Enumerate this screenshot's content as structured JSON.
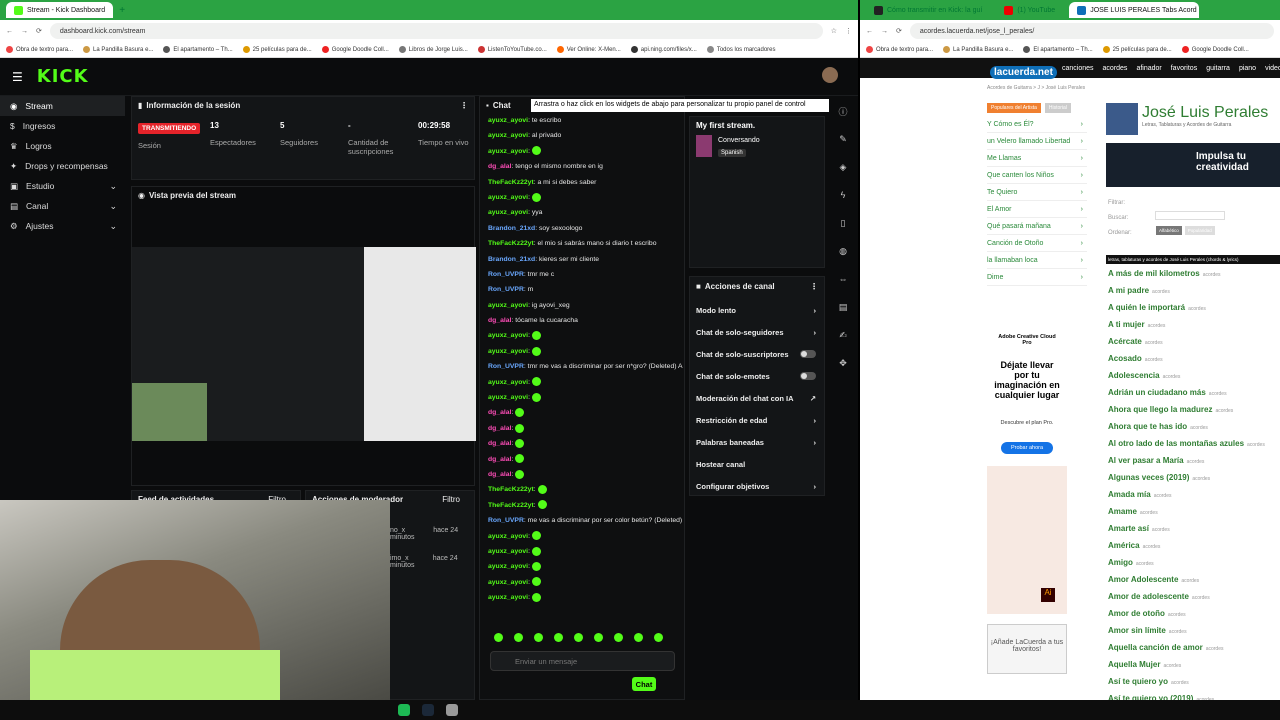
{
  "left_browser": {
    "tabs": [
      {
        "label": "Stream - Kick Dashboard"
      }
    ],
    "url": "dashboard.kick.com/stream",
    "bookmarks": [
      "Obra de textro para...",
      "La Pandilla Basura e...",
      "El apartamento – Th...",
      "25 películas para de...",
      "Google Doodle Coll...",
      "Libros de Jorge Luis...",
      "ListenToYouTube.co...",
      "Ver Online: X-Men...",
      "api.ning.com/files/x...",
      "Todos los marcadores"
    ]
  },
  "kick": {
    "logo": "KICK",
    "sidebar": [
      {
        "label": "Stream",
        "icon": "broadcast-icon"
      },
      {
        "label": "Ingresos",
        "icon": "money-icon"
      },
      {
        "label": "Logros",
        "icon": "trophy-icon"
      },
      {
        "label": "Drops y recompensas",
        "icon": "gift-icon"
      },
      {
        "label": "Estudio",
        "icon": "studio-icon"
      },
      {
        "label": "Canal",
        "icon": "channel-icon"
      },
      {
        "label": "Ajustes",
        "icon": "gear-icon"
      }
    ],
    "session": {
      "title": "Información de la sesión",
      "live_badge": "TRANSMITIENDO",
      "session_label": "Sesión",
      "stats": [
        {
          "value": "13",
          "label": "Espectadores"
        },
        {
          "value": "5",
          "label": "Seguidores"
        },
        {
          "value": "-",
          "label": "Cantidad de suscripciones"
        },
        {
          "value": "00:29:58",
          "label": "Tiempo en vivo"
        }
      ]
    },
    "preview": {
      "title": "Vista previa del stream"
    },
    "activity": {
      "title": "Feed de actividades",
      "filter": "Filtro"
    },
    "moderator": {
      "title": "Acciones de moderador",
      "filter": "Filtro",
      "rows": [
        {
          "user": "no_x",
          "time": "hace 24 minutos"
        },
        {
          "user": "imo_x",
          "time": "hace 24 minutos"
        }
      ]
    },
    "chat": {
      "title": "Chat",
      "tooltip": "Arrastra o haz click en los widgets de abajo para personalizar tu propio panel de control",
      "messages": [
        {
          "user": "ayuxz_ayovi",
          "text": "te escribo",
          "color": "g"
        },
        {
          "user": "ayuxz_ayovi",
          "text": "al privado",
          "color": "g"
        },
        {
          "user": "ayuxz_ayovi",
          "text": "",
          "color": "g"
        },
        {
          "user": "dg_alal",
          "text": "tengo el mismo nombre en ig",
          "color": "p"
        },
        {
          "user": "TheFacKz22yt",
          "text": "a mi si debes saber",
          "color": "g"
        },
        {
          "user": "ayuxz_ayovi",
          "text": "",
          "color": "g"
        },
        {
          "user": "ayuxz_ayovi",
          "text": "yya",
          "color": "g"
        },
        {
          "user": "Brandon_21xd",
          "text": "soy sexoologo",
          "color": "b"
        },
        {
          "user": "TheFacKz22yt",
          "text": "el mio si sabrás mano si diario t escribo",
          "color": "g"
        },
        {
          "user": "Brandon_21xd",
          "text": "kieres ser mi cliente",
          "color": "b"
        },
        {
          "user": "Ron_UVPR",
          "text": "tmr me c",
          "color": "b"
        },
        {
          "user": "Ron_UVPR",
          "text": "m",
          "color": "b"
        },
        {
          "user": "ayuxz_ayovi",
          "text": "ig ayovi_xeg",
          "color": "g"
        },
        {
          "user": "dg_alal",
          "text": "tócame la cucaracha",
          "color": "p"
        },
        {
          "user": "ayuxz_ayovi",
          "text": "",
          "color": "g"
        },
        {
          "user": "ayuxz_ayovi",
          "text": "",
          "color": "g"
        },
        {
          "user": "Ron_UVPR",
          "text": "tmr me vas a discriminar por ser n*gro? (Deleted) AI Mod [odio]",
          "color": "b"
        },
        {
          "user": "ayuxz_ayovi",
          "text": "",
          "color": "g"
        },
        {
          "user": "ayuxz_ayovi",
          "text": "",
          "color": "g"
        },
        {
          "user": "dg_alal",
          "text": "",
          "color": "p"
        },
        {
          "user": "dg_alal",
          "text": "",
          "color": "p"
        },
        {
          "user": "dg_alal",
          "text": "",
          "color": "p"
        },
        {
          "user": "dg_alal",
          "text": "",
          "color": "p"
        },
        {
          "user": "dg_alal",
          "text": "",
          "color": "p"
        },
        {
          "user": "TheFacKz22yt",
          "text": "",
          "color": "g"
        },
        {
          "user": "TheFacKz22yt",
          "text": "",
          "color": "g"
        },
        {
          "user": "Ron_UVPR",
          "text": "me vas a discriminar por ser color betún? (Deleted) AI Mod [odio]",
          "color": "b"
        },
        {
          "user": "ayuxz_ayovi",
          "text": "",
          "color": "g"
        },
        {
          "user": "ayuxz_ayovi",
          "text": "",
          "color": "g"
        },
        {
          "user": "ayuxz_ayovi",
          "text": "",
          "color": "g"
        },
        {
          "user": "ayuxz_ayovi",
          "text": "",
          "color": "g"
        },
        {
          "user": "ayuxz_ayovi",
          "text": "",
          "color": "g"
        }
      ],
      "input_placeholder": "Enviar un mensaje",
      "send_label": "Chat"
    },
    "stream_info": {
      "title": "My first stream.",
      "category": "Conversando",
      "language": "Spanish"
    },
    "channel_actions": {
      "title": "Acciones de canal",
      "items": [
        {
          "label": "Modo lento",
          "control": "chevron"
        },
        {
          "label": "Chat de solo-seguidores",
          "control": "chevron"
        },
        {
          "label": "Chat de solo-suscriptores",
          "control": "toggle"
        },
        {
          "label": "Chat de solo-emotes",
          "control": "toggle"
        },
        {
          "label": "Moderación del chat con IA",
          "control": "external"
        },
        {
          "label": "Restricción de edad",
          "control": "chevron"
        },
        {
          "label": "Palabras baneadas",
          "control": "chevron"
        },
        {
          "label": "Hostear canal",
          "control": "none"
        },
        {
          "label": "Configurar objetivos",
          "control": "chevron"
        }
      ]
    }
  },
  "right_browser": {
    "tabs": [
      {
        "label": "Cómo transmitir en Kick: la guí"
      },
      {
        "label": "(1) YouTube"
      },
      {
        "label": "JOSE LUIS PERALES Tabs Acord"
      }
    ],
    "url": "acordes.lacuerda.net/jose_l_perales/",
    "bookmarks": [
      "Obra de textro para...",
      "La Pandilla Basura e...",
      "El apartamento – Th...",
      "25 películas para de...",
      "Google Doodle Coll..."
    ]
  },
  "lacuerda": {
    "logo": "lacuerda.net",
    "nav": [
      "canciones",
      "acordes",
      "afinador",
      "favoritos",
      "guitarra",
      "piano",
      "videos"
    ],
    "breadcrumb": "Acordes de Guitarra > J > José Luis Perales",
    "artist": "José Luis Perales",
    "subtitle": "Letras, Tablaturas y Acordes de Guitarra",
    "tabs": [
      "Populares del Artista",
      "Historial"
    ],
    "popular": [
      "Y Cómo es Él?",
      "un Velero llamado Libertad",
      "Me Llamas",
      "Que canten los Niños",
      "Te Quiero",
      "El Amor",
      "Qué pasará mañana",
      "Canción de Otoño",
      "la llamaban loca",
      "Dime"
    ],
    "ad": {
      "tagline": "Impulsa tu creatividad",
      "product": "Adobe Creative Cloud Pro",
      "headline": "Déjate llevar por tu imaginación en cualquier lugar",
      "cta_text": "Descubre el plan Pro.",
      "cta": "Probar ahora"
    },
    "fav": "¡Añade LaCuerda a tus favoritos!",
    "filter_labels": [
      "Filtrar:",
      "Buscar:",
      "Ordenar:"
    ],
    "order_options": [
      "Alfabético",
      "Popularidad"
    ],
    "list_header": "letras, tablaturas y acordes de José Luis Perales (chords & lyrics)",
    "songs": [
      "A más de mil kilometros",
      "A mi padre",
      "A quién le importará",
      "A ti mujer",
      "Acércate",
      "Acosado",
      "Adolescencia",
      "Adrián un ciudadano más",
      "Ahora que llego la madurez",
      "Ahora que te has ido",
      "Al otro lado de las montañas azules",
      "Al ver pasar a María",
      "Algunas veces (2019)",
      "Amada mía",
      "Amame",
      "Amarte así",
      "América",
      "Amigo",
      "Amor Adolescente",
      "Amor de adolescente",
      "Amor de otoño",
      "Amor sin límite",
      "Aquella canción de amor",
      "Aquella Mujer",
      "Así te quiero yo",
      "Así te quiero yo (2019)"
    ],
    "song_tag": "acordes"
  },
  "colors": {
    "kick_green": "#53fc18",
    "chrome_green": "#2ba343",
    "live_red": "#e5232a"
  }
}
